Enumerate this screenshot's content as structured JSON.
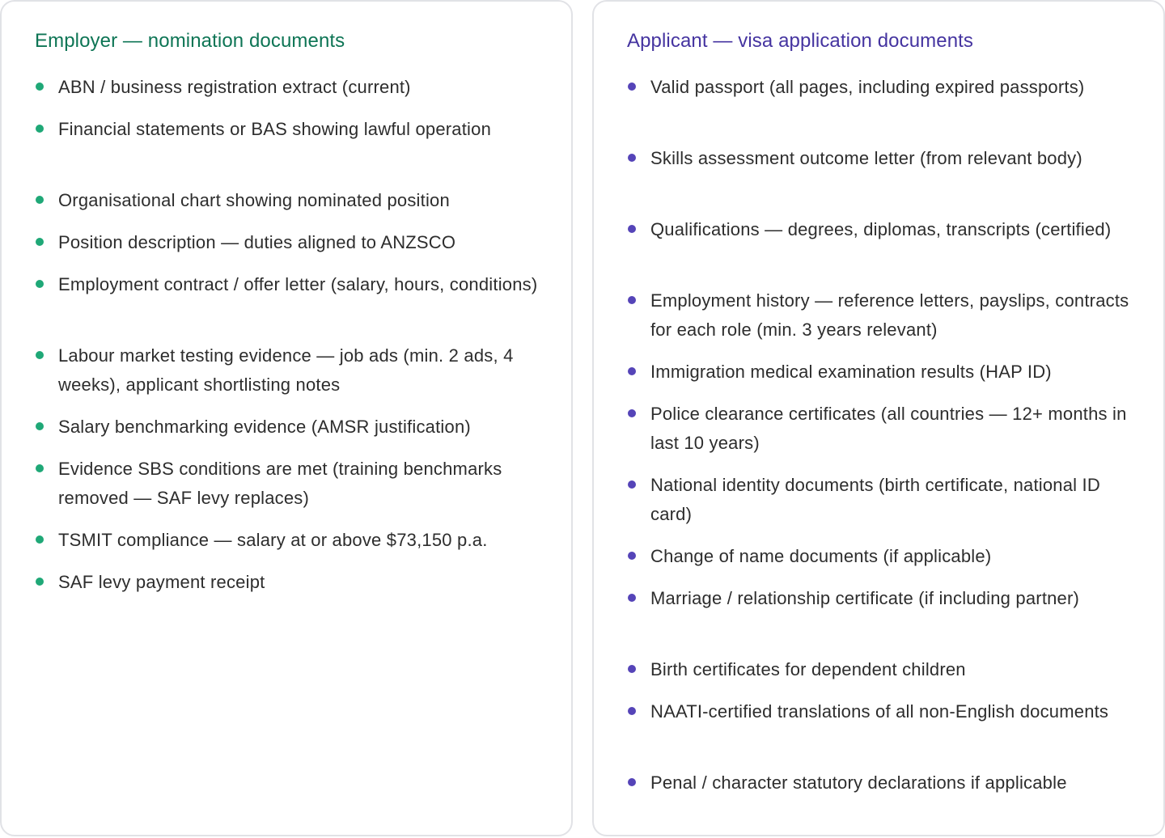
{
  "employer": {
    "title": "Employer — nomination documents",
    "accent_color": "#0e7555",
    "bullet_color": "#1fa877",
    "items": [
      "ABN / business registration extract (current)",
      "Financial statements or BAS showing lawful operation",
      "Organisational chart showing nominated position",
      "Position description — duties aligned to ANZSCO",
      "Employment contract / offer letter (salary, hours, conditions)",
      "Labour market testing evidence — job ads (min. 2 ads, 4 weeks), applicant shortlisting notes",
      "Salary benchmarking evidence (AMSR justification)",
      "Evidence SBS conditions are met (training benchmarks removed — SAF levy replaces)",
      "TSMIT compliance — salary at or above $73,150 p.a.",
      "SAF levy payment receipt"
    ]
  },
  "applicant": {
    "title": "Applicant — visa application documents",
    "accent_color": "#4534a0",
    "bullet_color": "#5544b8",
    "items": [
      "Valid passport (all pages, including expired passports)",
      "Skills assessment outcome letter (from relevant body)",
      "Qualifications — degrees, diplomas, transcripts (certified)",
      "Employment history — reference letters, payslips, contracts for each role (min. 3 years relevant)",
      "Immigration medical examination results (HAP ID)",
      "Police clearance certificates (all countries — 12+ months in last 10 years)",
      "National identity documents (birth certificate, national ID card)",
      "Change of name documents (if applicable)",
      "Marriage / relationship certificate (if including partner)",
      "Birth certificates for dependent children",
      "NAATI-certified translations of all non-English documents",
      "Penal / character statutory declarations if applicable"
    ]
  }
}
